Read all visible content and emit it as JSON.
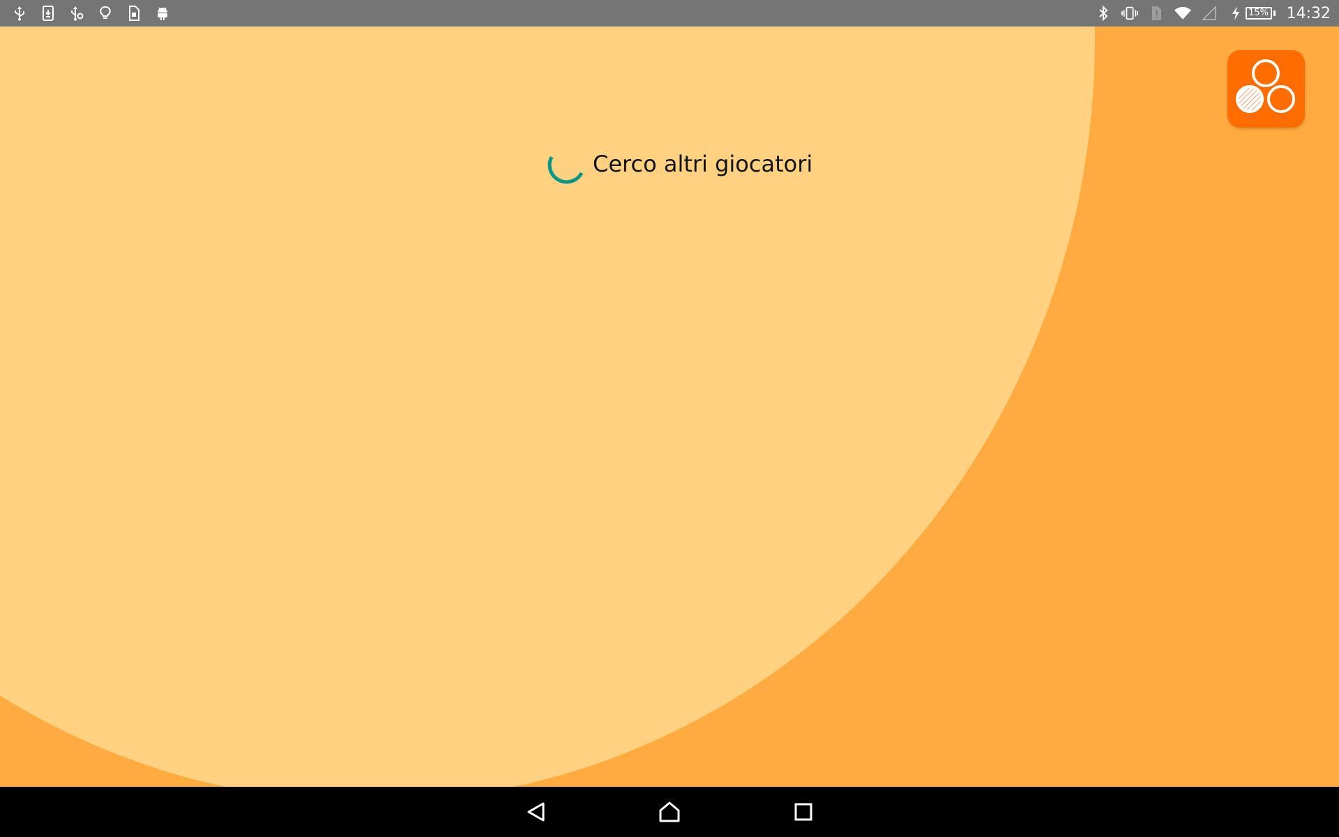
{
  "status_bar": {
    "left_icons": [
      "usb-icon",
      "download-icon",
      "usb-debug-icon",
      "lightbulb-icon",
      "sim-card-icon",
      "android-icon"
    ],
    "right_icons": [
      "bluetooth-icon",
      "vibrate-icon",
      "no-sim-icon",
      "wifi-icon",
      "cell-signal-icon",
      "charging-icon"
    ],
    "battery_percent": "15%",
    "time": "14:32"
  },
  "main": {
    "status_text": "Cerco altri giocatori",
    "spinner_color": "#009688",
    "app_icon_name": "three-circles-logo-icon"
  },
  "colors": {
    "background_outer": "#FFAB40",
    "background_inner": "#FFD180",
    "app_icon_bg": "#FF6D00",
    "status_bar": "#757575",
    "nav_bar": "#000000"
  },
  "nav_bar": {
    "buttons": [
      "back-icon",
      "home-icon",
      "recents-icon"
    ]
  }
}
